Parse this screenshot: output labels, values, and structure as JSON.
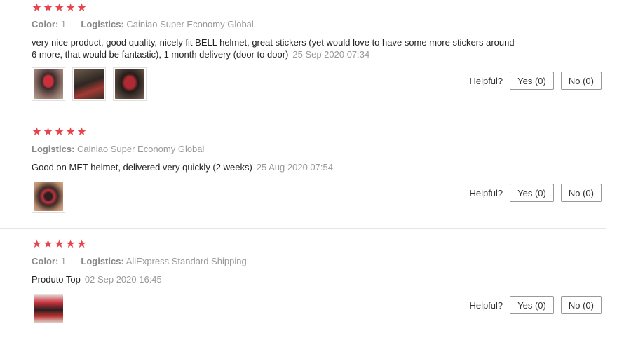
{
  "reviews": [
    {
      "stars": 5,
      "color_label": "Color:",
      "color_value": "1",
      "logistics_label": "Logistics:",
      "logistics_value": "Cainiao Super Economy Global",
      "text": "very nice product, good quality, nicely fit BELL helmet, great stickers (yet would love to have some more stickers around 6 more, that would be fantastic), 1 month delivery (door to door)",
      "date": "25 Sep 2020 07:34",
      "images": [
        "helmet-photo-1",
        "helmet-photo-2",
        "helmet-photo-3"
      ],
      "helpful_label": "Helpful?",
      "yes_label": "Yes (0)",
      "no_label": "No (0)"
    },
    {
      "stars": 5,
      "logistics_label": "Logistics:",
      "logistics_value": "Cainiao Super Economy Global",
      "text": "Good on MET helmet, delivered very quickly (2 weeks)",
      "date": "25 Aug 2020 07:54",
      "images": [
        "helmet-photo-1"
      ],
      "helpful_label": "Helpful?",
      "yes_label": "Yes (0)",
      "no_label": "No (0)"
    },
    {
      "stars": 5,
      "color_label": "Color:",
      "color_value": "1",
      "logistics_label": "Logistics:",
      "logistics_value": "AliExpress Standard Shipping",
      "text": "Produto Top",
      "date": "02 Sep 2020 16:45",
      "images": [
        "helmet-photo-1"
      ],
      "helpful_label": "Helpful?",
      "yes_label": "Yes (0)",
      "no_label": "No (0)"
    }
  ],
  "colors": {
    "star": "#e6434d",
    "divider": "#e6e6e6"
  }
}
